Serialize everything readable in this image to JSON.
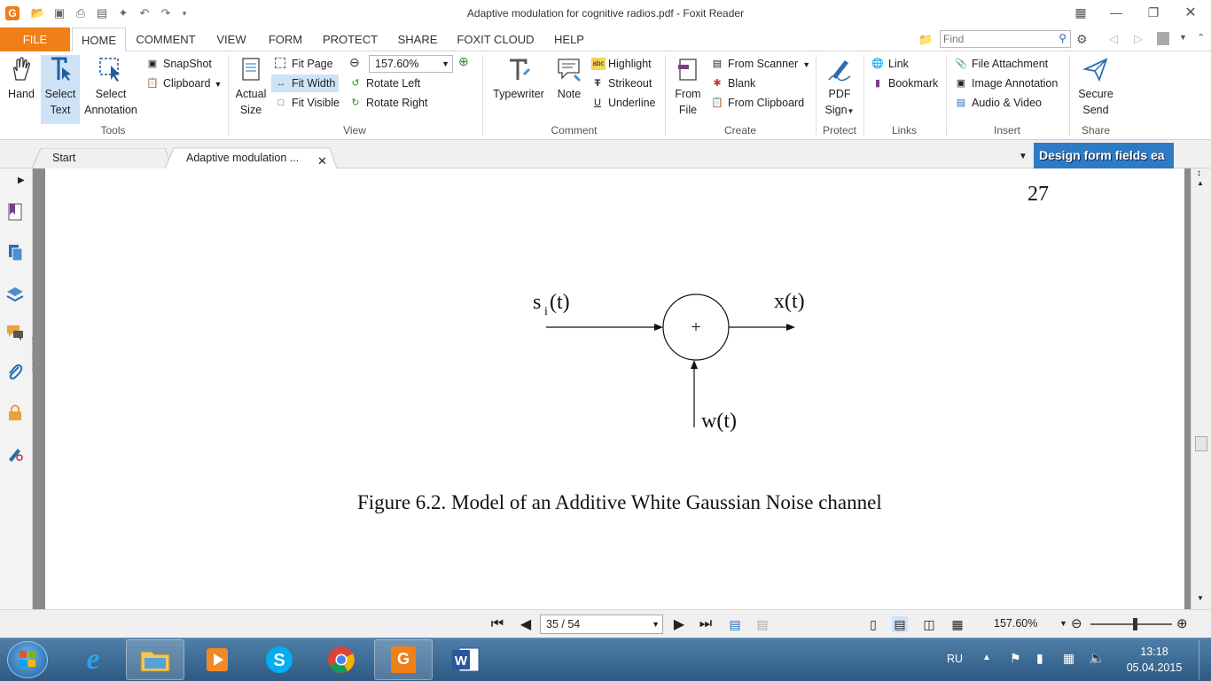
{
  "window": {
    "title": "Adaptive modulation for cognitive radios.pdf - Foxit Reader"
  },
  "menu": {
    "tabs": [
      "FILE",
      "HOME",
      "COMMENT",
      "VIEW",
      "FORM",
      "PROTECT",
      "SHARE",
      "FOXIT CLOUD",
      "HELP"
    ],
    "find_placeholder": "Find"
  },
  "ribbon": {
    "tools": {
      "hand": "Hand",
      "select_text_1": "Select",
      "select_text_2": "Text",
      "select_annot_1": "Select",
      "select_annot_2": "Annotation",
      "snapshot": "SnapShot",
      "clipboard": "Clipboard",
      "label": "Tools"
    },
    "view": {
      "actual_1": "Actual",
      "actual_2": "Size",
      "fit_page": "Fit Page",
      "fit_width": "Fit Width",
      "fit_visible": "Fit Visible",
      "zoom": "157.60%",
      "rotate_left": "Rotate Left",
      "rotate_right": "Rotate Right",
      "label": "View"
    },
    "comment": {
      "typewriter": "Typewriter",
      "note": "Note",
      "highlight": "Highlight",
      "strikeout": "Strikeout",
      "underline": "Underline",
      "label": "Comment"
    },
    "create": {
      "from_file_1": "From",
      "from_file_2": "File",
      "from_scanner": "From Scanner",
      "blank": "Blank",
      "from_clipboard": "From Clipboard",
      "label": "Create"
    },
    "protect": {
      "pdf_sign_1": "PDF",
      "pdf_sign_2": "Sign",
      "label": "Protect"
    },
    "links": {
      "link": "Link",
      "bookmark": "Bookmark",
      "label": "Links"
    },
    "insert": {
      "file_attachment": "File Attachment",
      "image_annotation": "Image Annotation",
      "audio_video": "Audio & Video",
      "label": "Insert"
    },
    "share": {
      "secure_1": "Secure",
      "secure_2": "Send",
      "label": "Share"
    }
  },
  "tabs": {
    "start": "Start",
    "doc": "Adaptive modulation ...",
    "ad": "Design form fields ea"
  },
  "document": {
    "page_number": "27",
    "diagram": {
      "input": "s",
      "input_sub": "i",
      "input_arg": "(t)",
      "output": "x(t)",
      "noise": "w(t)",
      "adder": "+"
    },
    "caption": "Figure 6.2.  Model of an Additive White Gaussian Noise channel"
  },
  "status": {
    "page": "35 / 54",
    "zoom": "157.60%"
  },
  "taskbar": {
    "lang": "RU",
    "time": "13:18",
    "date": "05.04.2015"
  },
  "colors": {
    "accent": "#f07f17",
    "selected": "#cfe3f6",
    "taskbar": "#2d5a84"
  }
}
